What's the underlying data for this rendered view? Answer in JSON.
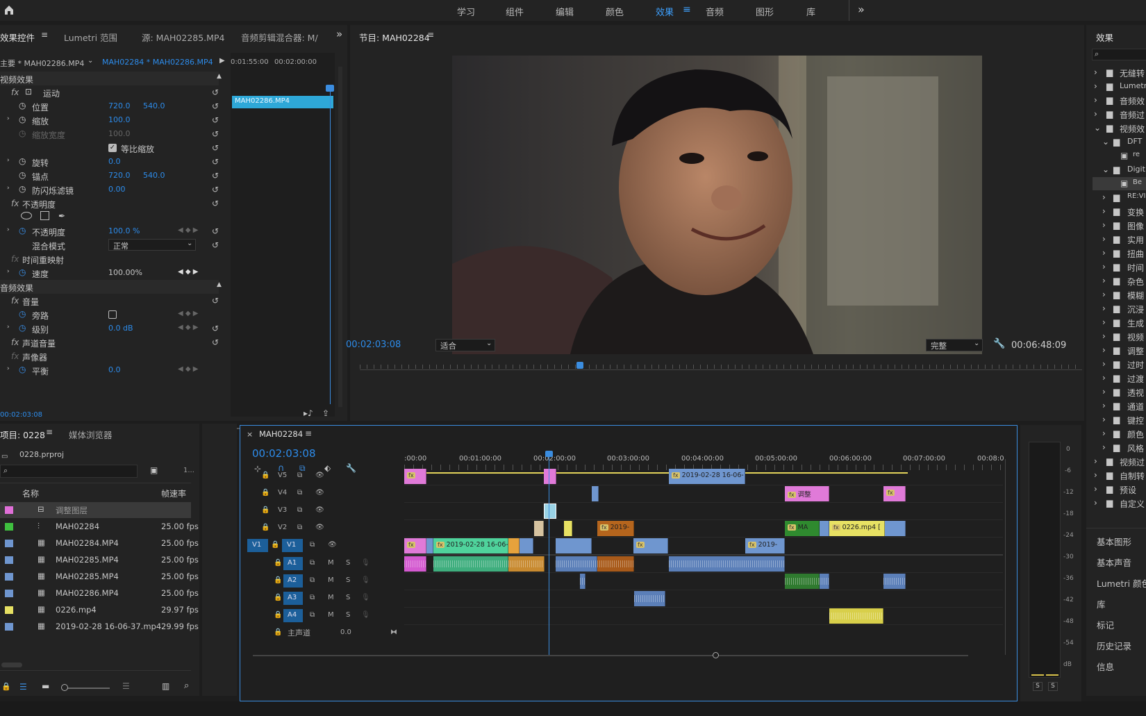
{
  "workspaces": [
    "学习",
    "组件",
    "编辑",
    "颜色",
    "效果",
    "音频",
    "图形",
    "库"
  ],
  "active_workspace": "效果",
  "effect_controls": {
    "tabs": [
      "效果控件",
      "Lumetri 范围",
      "源: MAH02285.MP4",
      "音频剪辑混合器: M/"
    ],
    "master_label": "主要 * MAH02286.MP4",
    "sequence_label": "MAH02284 * MAH02286.MP4",
    "ruler_times": [
      "0:01:55:00",
      "00:02:00:00"
    ],
    "clip_name": "MAH02286.MP4",
    "video_section": "视频效果",
    "audio_section": "音频效果",
    "rows": [
      {
        "name": "运动",
        "type": "group"
      },
      {
        "name": "位置",
        "v1": "720.0",
        "v2": "540.0"
      },
      {
        "name": "缩放",
        "v1": "100.0",
        "v2": ""
      },
      {
        "name": "缩放宽度",
        "v1": "100.0",
        "v2": "",
        "dim": true
      },
      {
        "name": "等比缩放",
        "checkbox": true
      },
      {
        "name": "旋转",
        "v1": "0.0",
        "v2": ""
      },
      {
        "name": "锚点",
        "v1": "720.0",
        "v2": "540.0"
      },
      {
        "name": "防闪烁滤镜",
        "v1": "0.00",
        "v2": ""
      },
      {
        "name": "不透明度",
        "type": "group"
      },
      {
        "name": "不透明度",
        "v1": "100.0 %",
        "v2": ""
      },
      {
        "name": "混合模式",
        "select": "正常"
      },
      {
        "name": "时间重映射",
        "type": "group"
      },
      {
        "name": "速度",
        "v1": "100.00%",
        "v2": ""
      }
    ],
    "audio_rows": [
      {
        "name": "音量",
        "type": "group"
      },
      {
        "name": "旁路",
        "checkbox": true
      },
      {
        "name": "级别",
        "v1": "0.0 dB"
      },
      {
        "name": "声道音量",
        "type": "group"
      },
      {
        "name": "声像器",
        "type": "group"
      },
      {
        "name": "平衡",
        "v1": "0.0"
      }
    ],
    "timecode": "00:02:03:08"
  },
  "program": {
    "title": "节目: MAH02284",
    "timecode": "00:02:03:08",
    "fit": "适合",
    "quality": "完整",
    "duration": "00:06:48:09"
  },
  "project": {
    "tabs": [
      "项目: 0228",
      "媒体浏览器"
    ],
    "file": "0228.prproj",
    "count": "1...",
    "col_name": "名称",
    "col_fps": "帧速率",
    "items": [
      {
        "name": "调整图层",
        "fps": "",
        "color": "#e06fd8"
      },
      {
        "name": "MAH02284",
        "fps": "25.00 fps",
        "color": "#3fbf3f"
      },
      {
        "name": "MAH02284.MP4",
        "fps": "25.00 fps",
        "color": "#6f96cf"
      },
      {
        "name": "MAH02285.MP4",
        "fps": "25.00 fps",
        "color": "#6f96cf"
      },
      {
        "name": "MAH02285.MP4",
        "fps": "25.00 fps",
        "color": "#6f96cf"
      },
      {
        "name": "MAH02286.MP4",
        "fps": "25.00 fps",
        "color": "#6f96cf"
      },
      {
        "name": "0226.mp4",
        "fps": "29.97 fps",
        "color": "#e7e163"
      },
      {
        "name": "2019-02-28 16-06-37.mp4",
        "fps": "29.99 fps",
        "color": "#6f96cf"
      }
    ]
  },
  "timeline": {
    "title": "MAH02284",
    "timecode": "00:02:03:08",
    "ruler": [
      ":00:00",
      "00:01:00:00",
      "00:02:00:00",
      "00:03:00:00",
      "00:04:00:00",
      "00:05:00:00",
      "00:06:00:00",
      "00:07:00:00",
      "00:08:0"
    ],
    "video_tracks": [
      "V5",
      "V4",
      "V3",
      "V2",
      "V1"
    ],
    "audio_tracks": [
      "A1",
      "A2",
      "A3",
      "A4"
    ],
    "master": "主声道",
    "master_val": "0.0",
    "clip_labels": {
      "v5_a": "2019-02-28 16-06-",
      "v4_a": "调整",
      "v2_a": "2019-",
      "v2_b": "MA",
      "v2_c": "0226.mp4 [",
      "v1_a": "2019-02-28 16-06-",
      "v1_b": "2019-"
    }
  },
  "effects_panel": {
    "title": "效果",
    "items": [
      "无缝转",
      "Lumetri",
      "音频效",
      "音频过",
      "视频效",
      "DFT",
      "re",
      "Digit",
      "Be",
      "RE:VI",
      "变换",
      "图像",
      "实用",
      "扭曲",
      "时间",
      "杂色",
      "模糊",
      "沉浸",
      "生成",
      "视频",
      "调整",
      "过时",
      "过渡",
      "透视",
      "通道",
      "键控",
      "颜色",
      "风格",
      "视频过",
      "自制转",
      "预设",
      "自定义"
    ]
  },
  "right_panels": [
    "基本图形",
    "基本声音",
    "Lumetri 颜色",
    "库",
    "标记",
    "历史记录",
    "信息"
  ],
  "vu_labels": [
    "0",
    "-6",
    "-12",
    "-18",
    "-24",
    "-30",
    "-36",
    "-42",
    "-48",
    "-54",
    "dB"
  ]
}
